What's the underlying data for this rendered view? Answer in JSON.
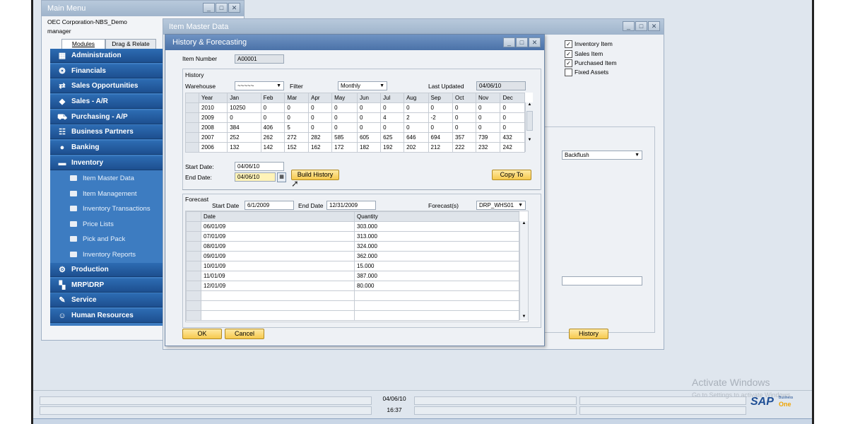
{
  "main_menu": {
    "title": "Main Menu",
    "company": "OEC Corporation-NBS_Demo",
    "user": "manager",
    "tabs": [
      "Modules",
      "Drag & Relate"
    ],
    "modules": [
      {
        "label": "Administration",
        "icon": "administration-icon"
      },
      {
        "label": "Financials",
        "icon": "financials-icon"
      },
      {
        "label": "Sales Opportunities",
        "icon": "sales-opportunities-icon"
      },
      {
        "label": "Sales - A/R",
        "icon": "sales-icon"
      },
      {
        "label": "Purchasing - A/P",
        "icon": "purchasing-icon"
      },
      {
        "label": "Business Partners",
        "icon": "business-partners-icon"
      },
      {
        "label": "Banking",
        "icon": "banking-icon"
      },
      {
        "label": "Inventory",
        "icon": "inventory-icon"
      }
    ],
    "inventory_sub": [
      "Item Master Data",
      "Item Management",
      "Inventory Transactions",
      "Price Lists",
      "Pick and Pack",
      "Inventory Reports"
    ],
    "modules_after": [
      {
        "label": "Production",
        "icon": "production-icon"
      },
      {
        "label": "MRP\\DRP",
        "icon": "mrp-icon"
      },
      {
        "label": "Service",
        "icon": "service-icon"
      },
      {
        "label": "Human Resources",
        "icon": "human-resources-icon"
      }
    ]
  },
  "item_master": {
    "title": "Item Master Data",
    "checkboxes": [
      {
        "label": "Inventory Item",
        "checked": true
      },
      {
        "label": "Sales Item",
        "checked": true
      },
      {
        "label": "Purchased Item",
        "checked": true
      },
      {
        "label": "Fixed Assets",
        "checked": false
      }
    ],
    "backflush_value": "Backflush",
    "history_button": "History"
  },
  "history_forecasting": {
    "title": "History & Forecasting",
    "item_number_label": "Item Number",
    "item_number": "A00001",
    "history": {
      "section_label": "History",
      "warehouse_label": "Warehouse",
      "warehouse_value": "~~~~~",
      "filter_label": "Filter",
      "filter_value": "Monthly",
      "last_updated_label": "Last Updated",
      "last_updated": "04/06/10",
      "columns": [
        "Year",
        "Jan",
        "Feb",
        "Mar",
        "Apr",
        "May",
        "Jun",
        "Jul",
        "Aug",
        "Sep",
        "Oct",
        "Nov",
        "Dec"
      ],
      "rows": [
        [
          "2010",
          "10250",
          "0",
          "0",
          "0",
          "0",
          "0",
          "0",
          "0",
          "0",
          "0",
          "0",
          "0"
        ],
        [
          "2009",
          "0",
          "0",
          "0",
          "0",
          "0",
          "0",
          "4",
          "2",
          "-2",
          "0",
          "0",
          "0"
        ],
        [
          "2008",
          "384",
          "406",
          "5",
          "0",
          "0",
          "0",
          "0",
          "0",
          "0",
          "0",
          "0",
          "0"
        ],
        [
          "2007",
          "252",
          "262",
          "272",
          "282",
          "585",
          "605",
          "625",
          "646",
          "694",
          "357",
          "739",
          "432"
        ],
        [
          "2006",
          "132",
          "142",
          "152",
          "162",
          "172",
          "182",
          "192",
          "202",
          "212",
          "222",
          "232",
          "242"
        ]
      ],
      "start_date_label": "Start Date:",
      "start_date": "04/06/10",
      "end_date_label": "End Date:",
      "end_date": "04/06/10",
      "build_history": "Build History",
      "copy_to": "Copy To"
    },
    "forecast": {
      "section_label": "Forecast",
      "start_date_label": "Start Date",
      "start_date": "6/1/2009",
      "end_date_label": "End Date",
      "end_date": "12/31/2009",
      "forecasts_label": "Forecast(s)",
      "forecasts_value": "DRP_WHS01",
      "columns": [
        "Date",
        "Quantity"
      ],
      "rows": [
        [
          "06/01/09",
          "303.000"
        ],
        [
          "07/01/09",
          "313.000"
        ],
        [
          "08/01/09",
          "324.000"
        ],
        [
          "09/01/09",
          "362.000"
        ],
        [
          "10/01/09",
          "15.000"
        ],
        [
          "11/01/09",
          "387.000"
        ],
        [
          "12/01/09",
          "80.000"
        ]
      ]
    },
    "ok": "OK",
    "cancel": "Cancel"
  },
  "status_bar": {
    "date": "04/06/10",
    "time": "16:37"
  },
  "watermark": {
    "line1": "Activate Windows",
    "line2": "Go to Settings to activate Windows."
  },
  "brand": {
    "sap": "SAP",
    "sub": "Business",
    "one": "One"
  },
  "colors": {
    "menu_blue": "#1d4f8f",
    "button_yellow": "#f6c94d"
  }
}
